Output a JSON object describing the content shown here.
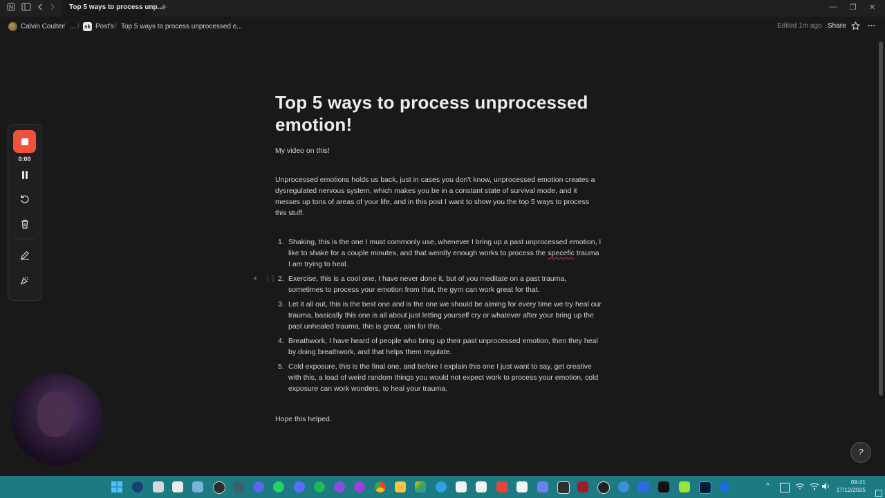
{
  "window": {
    "tab_title": "Top 5 ways to process unp...",
    "new_tab": "+",
    "minimize": "—",
    "restore": "❐",
    "close": "✕"
  },
  "breadcrumb": {
    "workspace": "Calvin Coulter",
    "ellipsis": "...",
    "parent_icon_text": "sk",
    "parent": "Post's",
    "current": "Top 5 ways to process unprocessed e...",
    "separator": "/"
  },
  "header_actions": {
    "edited": "Edited 1m ago",
    "share": "Share",
    "favorite_icon": "star-icon",
    "more": "···"
  },
  "document": {
    "title": "Top 5 ways to process unprocessed emotion!",
    "video_line": "My video on this!",
    "intro": "Unprocessed emotions holds us back, just in cases you don't know, unprocessed emotion creates a dysregulated nervous system, which makes you be in a constant state of survival mode, and it messes up tons of areas of your life, and in this post I want to show you the top 5 ways to process this stuff.",
    "items": [
      {
        "num": "1.",
        "text_a": "Shaking, this is the one I must commonly use, whenever I bring up a past unprocessed emotion, I like to shake for a couple minutes, and that weirdly enough works to process the ",
        "misspelled": "specefic",
        "text_b": " trauma I am trying to heal."
      },
      {
        "num": "2.",
        "text": "Exercise, this is a cool one, I have never done it, but of you meditate on a past trauma, sometimes to process your emotion from that, the gym can work great for that."
      },
      {
        "num": "3.",
        "text": "Let it all out, this is the best one and is the one we should be aiming for every time we try heal our trauma, basically this one is all about just letting yourself cry or whatever after your bring up the past unhealed trauma, this is great, aim for this."
      },
      {
        "num": "4.",
        "text": "Breathwork, I have heard of people who bring up their past unprocessed emotion, then they heal by doing breathwork, and that helps them regulate."
      },
      {
        "num": "5.",
        "text": "Cold exposure, this is the final one, and before I explain this one I just want to say, get creative with this, a load of weird random things you would not expect work to process your emotion, cold exposure can work wonders, to heal your trauma."
      }
    ],
    "closing": "Hope this helped."
  },
  "block_handle": {
    "add": "+",
    "drag": "⋮⋮"
  },
  "recorder": {
    "timer": "0:00",
    "icons": [
      "stop-icon",
      "pause-icon",
      "restart-icon",
      "trash-icon",
      "pen-icon",
      "confetti-icon"
    ]
  },
  "help_button": "?",
  "taskbar": {
    "time": "09:41",
    "date": "17/12/2025",
    "tray_chevron": "^"
  },
  "colors": {
    "background": "#191919",
    "stop_button": "#f0513a",
    "taskbar": "#1c7a82"
  }
}
